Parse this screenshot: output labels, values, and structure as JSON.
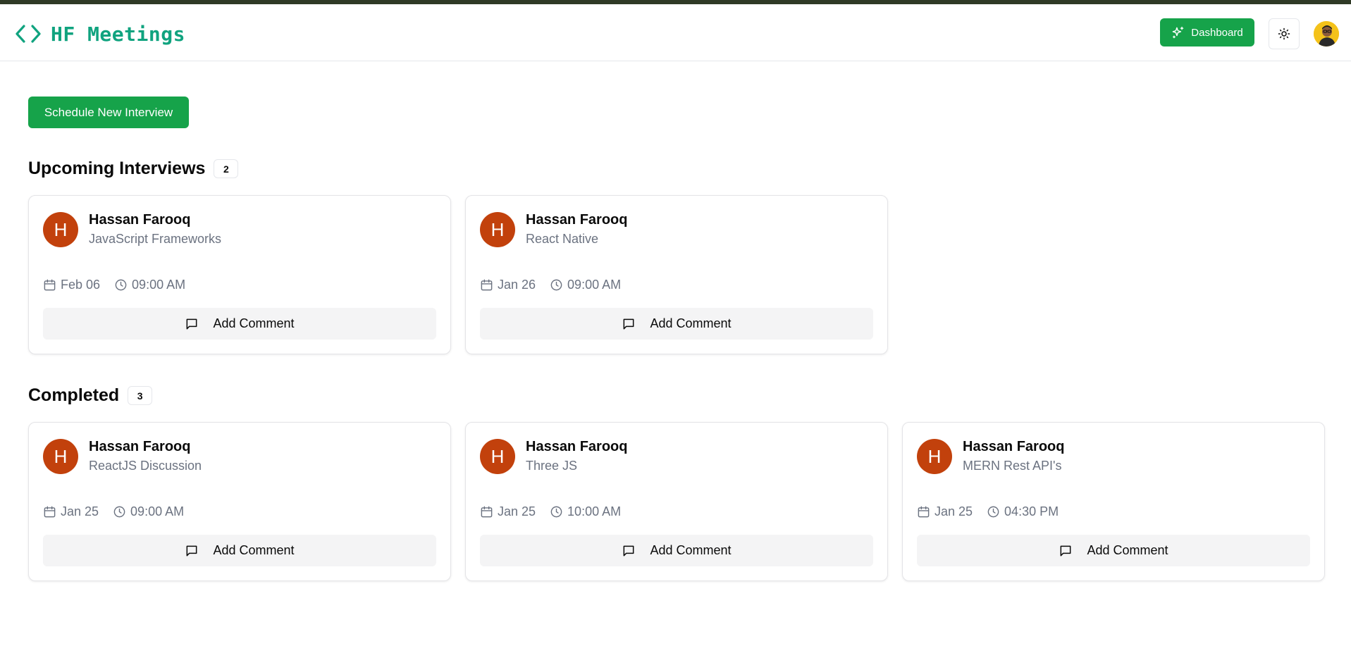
{
  "colors": {
    "brand": "#10a37f",
    "primary_button": "#16a34a",
    "avatar_bg": "#c2410c",
    "muted_text": "#6b7280"
  },
  "header": {
    "logo_icon": "code-brackets-icon",
    "app_title": "HF Meetings",
    "dashboard_label": "Dashboard",
    "dashboard_icon": "sparkles-icon",
    "theme_icon": "sun-icon",
    "user_avatar_icon": "user-avatar"
  },
  "actions": {
    "schedule_label": "Schedule New Interview"
  },
  "upcoming": {
    "title": "Upcoming Interviews",
    "count": "2",
    "items": [
      {
        "initial": "H",
        "name": "Hassan Farooq",
        "topic": "JavaScript Frameworks",
        "date": "Feb 06",
        "time": "09:00 AM",
        "comment_label": "Add Comment"
      },
      {
        "initial": "H",
        "name": "Hassan Farooq",
        "topic": "React Native",
        "date": "Jan 26",
        "time": "09:00 AM",
        "comment_label": "Add Comment"
      }
    ]
  },
  "completed": {
    "title": "Completed",
    "count": "3",
    "items": [
      {
        "initial": "H",
        "name": "Hassan Farooq",
        "topic": "ReactJS Discussion",
        "date": "Jan 25",
        "time": "09:00 AM",
        "comment_label": "Add Comment"
      },
      {
        "initial": "H",
        "name": "Hassan Farooq",
        "topic": "Three JS",
        "date": "Jan 25",
        "time": "10:00 AM",
        "comment_label": "Add Comment"
      },
      {
        "initial": "H",
        "name": "Hassan Farooq",
        "topic": "MERN Rest API's",
        "date": "Jan 25",
        "time": "04:30 PM",
        "comment_label": "Add Comment"
      }
    ]
  }
}
